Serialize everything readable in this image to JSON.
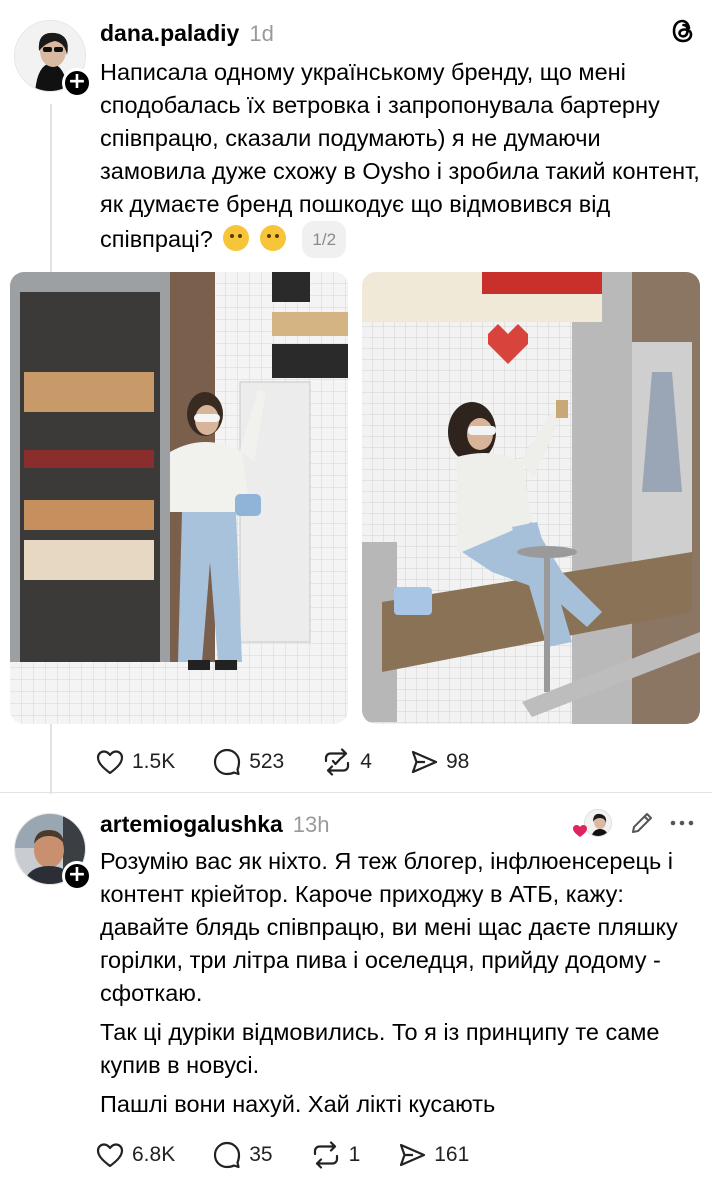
{
  "post": {
    "username": "dana.paladiy",
    "time": "1d",
    "text": "Написала одному українському бренду, що мені сподобалась їх ветровка і запропонувала бартерну співпрацю, сказали подумають) я не думаючи замовила дуже схожу в Oysho і зробила такий контент, як думаєте бренд пошкодує що відмовився від співпраці?",
    "emojis": [
      "thinking-face",
      "hand-over-mouth-face"
    ],
    "pager": "1/2",
    "stats": {
      "likes": "1.5K",
      "replies": "523",
      "reposts": "4",
      "shares": "98"
    }
  },
  "reply": {
    "username": "artemiogalushka",
    "time": "13h",
    "paragraphs": [
      "Розумію вас як ніхто. Я теж блогер, інфлюенсерець і контент кріейтор. Кароче приходжу в АТБ, кажу: давайте блядь співпрацю, ви мені щас даєте пляшку горілки, три літра пива і оселедця, прийду додому - сфоткаю.",
      "Так ці дуріки відмовились. То я із принципу те саме купив в новусі.",
      "Пашлі вони нахуй. Хай лікті кусають"
    ],
    "stats": {
      "likes": "6.8K",
      "replies": "35",
      "reposts": "1",
      "shares": "161"
    }
  },
  "icons": {
    "app_logo": "threads-logo-icon",
    "follow": "plus-icon",
    "like": "heart-icon",
    "reply": "speech-bubble-icon",
    "repost": "repost-icon",
    "share": "send-icon",
    "liked_by_author": "red-heart-icon",
    "edit": "pencil-icon",
    "more": "more-dots-icon"
  },
  "colors": {
    "text": "#000000",
    "muted": "#9a9a9a",
    "divider": "#e4e4e4",
    "heart": "#e0245e"
  }
}
